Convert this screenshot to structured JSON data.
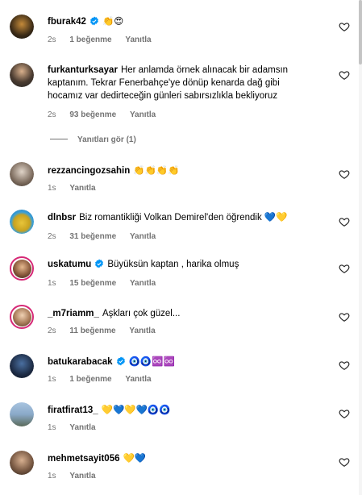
{
  "colors": {
    "meta": "#737373",
    "verified": "#0095f6",
    "story_ring": "#d62976"
  },
  "comments": [
    {
      "username": "fburak42",
      "verified": true,
      "text": "👏😍",
      "time": "2s",
      "likes": "1 beğenme",
      "reply": "Yanıtla"
    },
    {
      "username": "furkanturksayar",
      "verified": false,
      "text": "Her anlamda örnek alınacak bir adamsın kaptanım. Tekrar Fenerbahçe'ye dönüp kenarda dağ gibi hocamız var dedirteceğin günleri sabırsızlıkla bekliyoruz",
      "time": "2s",
      "likes": "93 beğenme",
      "reply": "Yanıtla"
    },
    {
      "username": "rezzancingozsahin",
      "verified": false,
      "text": "👏👏👏👏",
      "time": "1s",
      "likes": "",
      "reply": "Yanıtla"
    },
    {
      "username": "dlnbsr",
      "verified": false,
      "text": "Biz romantikliği Volkan Demirel'den öğrendik 💙💛",
      "time": "2s",
      "likes": "31 beğenme",
      "reply": "Yanıtla"
    },
    {
      "username": "uskatumu",
      "verified": true,
      "text": "Büyüksün kaptan , harika olmuş",
      "time": "1s",
      "likes": "15 beğenme",
      "reply": "Yanıtla"
    },
    {
      "username": "_m7riamm_",
      "verified": false,
      "text": "Aşkları çok güzel...",
      "time": "2s",
      "likes": "11 beğenme",
      "reply": "Yanıtla"
    },
    {
      "username": "batukarabacak",
      "verified": true,
      "text": "🧿🧿♾️♾️",
      "time": "1s",
      "likes": "1 beğenme",
      "reply": "Yanıtla"
    },
    {
      "username": "firatfirat13_",
      "verified": false,
      "text": "💛💙💛💙🧿🧿",
      "time": "1s",
      "likes": "",
      "reply": "Yanıtla"
    },
    {
      "username": "mehmetsayit056",
      "verified": false,
      "text": "💛💙",
      "time": "1s",
      "likes": "",
      "reply": "Yanıtla"
    }
  ],
  "view_replies": "Yanıtları gör (1)"
}
